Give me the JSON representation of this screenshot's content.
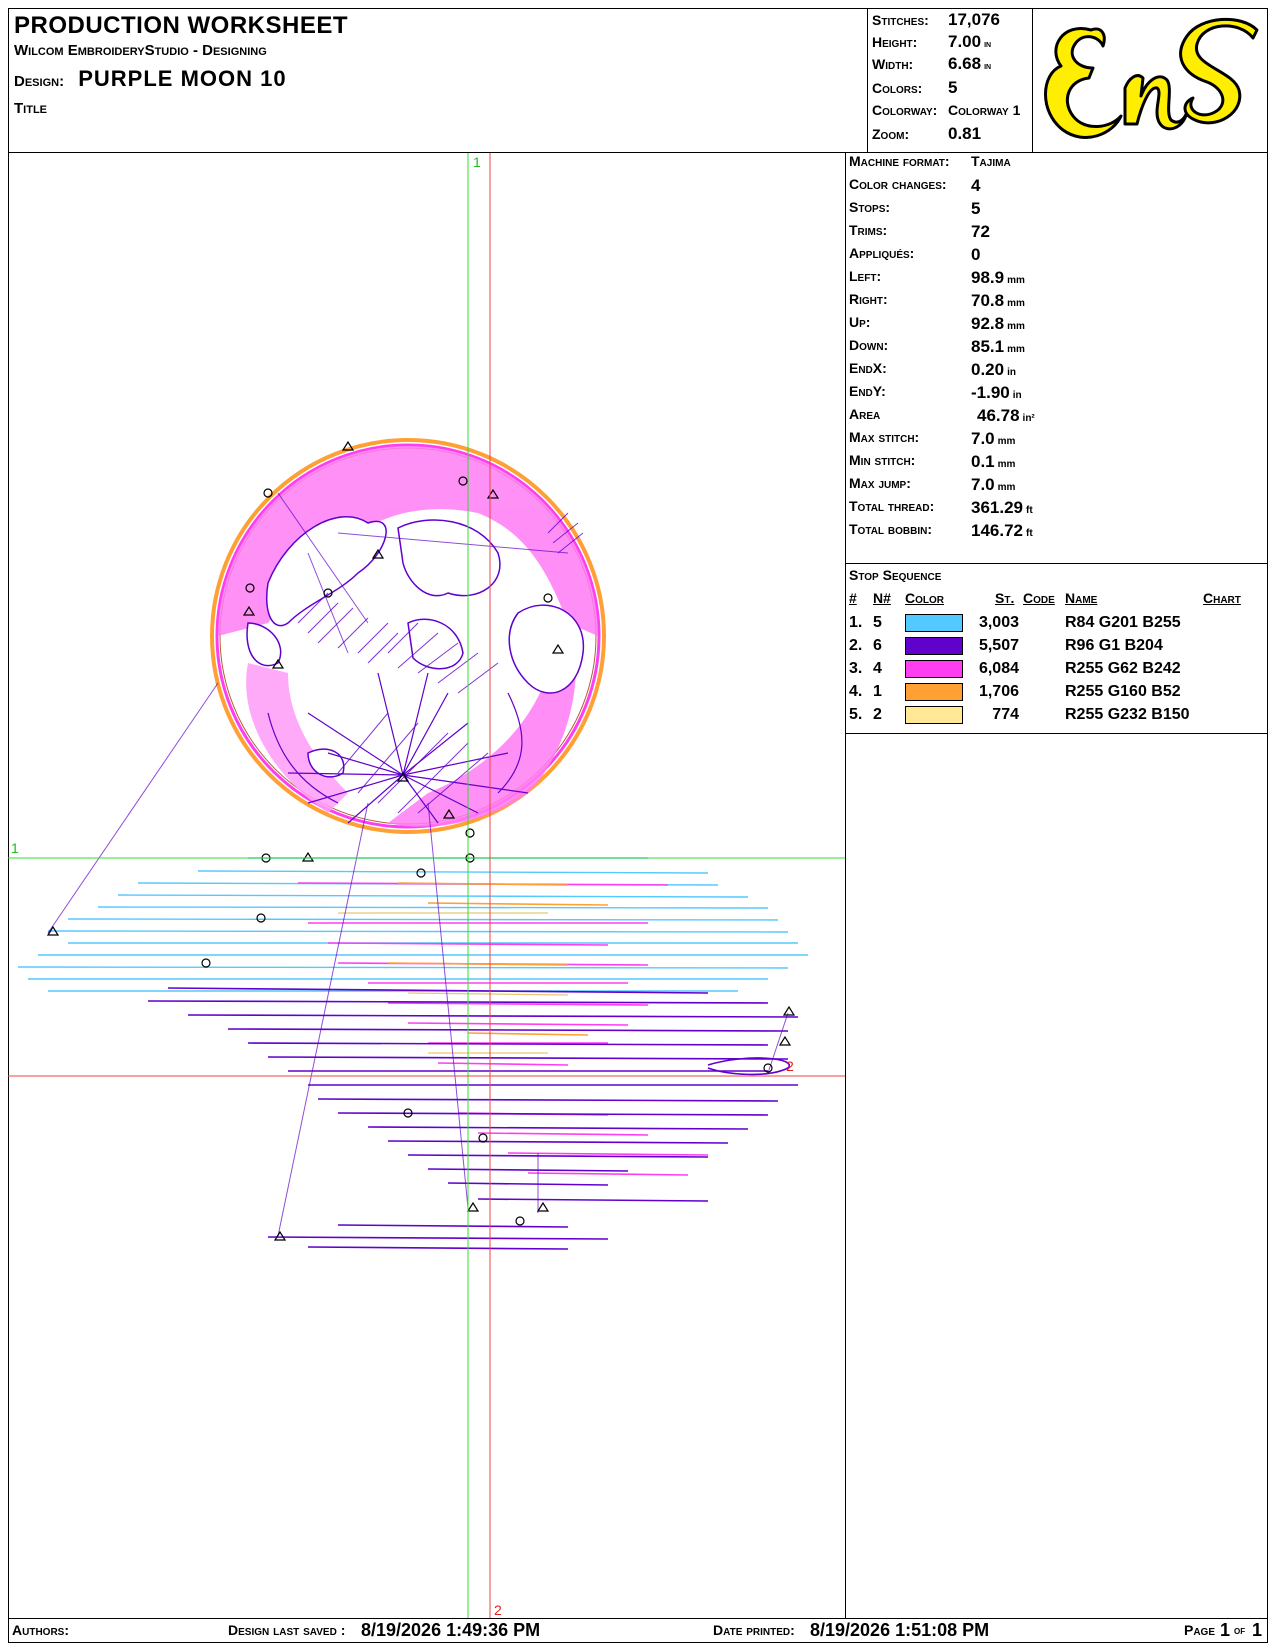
{
  "header": {
    "title": "PRODUCTION WORKSHEET",
    "software": "Wilcom EmbroideryStudio - Designing",
    "design_label": "Design:",
    "design_name": "PURPLE MOON  10",
    "title_label": "Title"
  },
  "stats": [
    {
      "key": "Stitches:",
      "value": "17,076",
      "unit": ""
    },
    {
      "key": "Height:",
      "value": "7.00",
      "unit": "in"
    },
    {
      "key": "Width:",
      "value": "6.68",
      "unit": "in"
    },
    {
      "key": "Colors:",
      "value": "5",
      "unit": ""
    },
    {
      "key": "Colorway:",
      "value": "Colorway 1",
      "unit": ""
    },
    {
      "key": "Zoom:",
      "value": "0.81",
      "unit": ""
    }
  ],
  "logo": {
    "text": "EnS",
    "color": "#ffee00"
  },
  "info": [
    {
      "key": "Machine format:",
      "value": "Tajima",
      "unit": ""
    },
    {
      "key": "Color changes:",
      "value": "4",
      "unit": ""
    },
    {
      "key": "Stops:",
      "value": "5",
      "unit": ""
    },
    {
      "key": "Trims:",
      "value": "72",
      "unit": ""
    },
    {
      "key": "Appliqués:",
      "value": "0",
      "unit": ""
    },
    {
      "key": "Left:",
      "value": "98.9",
      "unit": "mm"
    },
    {
      "key": "Right:",
      "value": "70.8",
      "unit": "mm"
    },
    {
      "key": "Up:",
      "value": "92.8",
      "unit": "mm"
    },
    {
      "key": "Down:",
      "value": "85.1",
      "unit": "mm"
    },
    {
      "key": "EndX:",
      "value": "0.20",
      "unit": "in"
    },
    {
      "key": "EndY:",
      "value": "-1.90",
      "unit": "in"
    },
    {
      "key": "Area",
      "value": "46.78",
      "unit": "in²"
    },
    {
      "key": "Max stitch:",
      "value": "7.0",
      "unit": "mm"
    },
    {
      "key": "Min stitch:",
      "value": "0.1",
      "unit": "mm"
    },
    {
      "key": "Max jump:",
      "value": "7.0",
      "unit": "mm"
    },
    {
      "key": "Total thread:",
      "value": "361.29",
      "unit": "ft"
    },
    {
      "key": "Total bobbin:",
      "value": "146.72",
      "unit": "ft"
    }
  ],
  "stop_sequence": {
    "title": "Stop Sequence",
    "headers": {
      "num": "#",
      "n": "N#",
      "color": "Color",
      "st": "St.",
      "code": "Code",
      "name": "Name",
      "chart": "Chart"
    },
    "rows": [
      {
        "num": "1.",
        "n": "5",
        "color": "#54c9ff",
        "stitches": "3,003",
        "name": "R84 G201 B255"
      },
      {
        "num": "2.",
        "n": "6",
        "color": "#6001cc",
        "stitches": "5,507",
        "name": "R96 G1 B204"
      },
      {
        "num": "3.",
        "n": "4",
        "color": "#ff3ef2",
        "stitches": "6,084",
        "name": "R255 G62 B242"
      },
      {
        "num": "4.",
        "n": "1",
        "color": "#ffa034",
        "stitches": "1,706",
        "name": "R255 G160 B52"
      },
      {
        "num": "5.",
        "n": "2",
        "color": "#ffe896",
        "stitches": "774",
        "name": "R255 G232 B150"
      }
    ]
  },
  "axis_labels": {
    "a1": "1",
    "a2": "2"
  },
  "footer": {
    "authors": "Authors:",
    "saved_label": "Design last saved :",
    "saved_value": "8/19/2026 1:49:36 PM",
    "printed_label": "Date printed:",
    "printed_value": "8/19/2026 1:51:08 PM",
    "page_label": "Page",
    "page_value": "1",
    "of_label": "of",
    "of_value": "1"
  }
}
